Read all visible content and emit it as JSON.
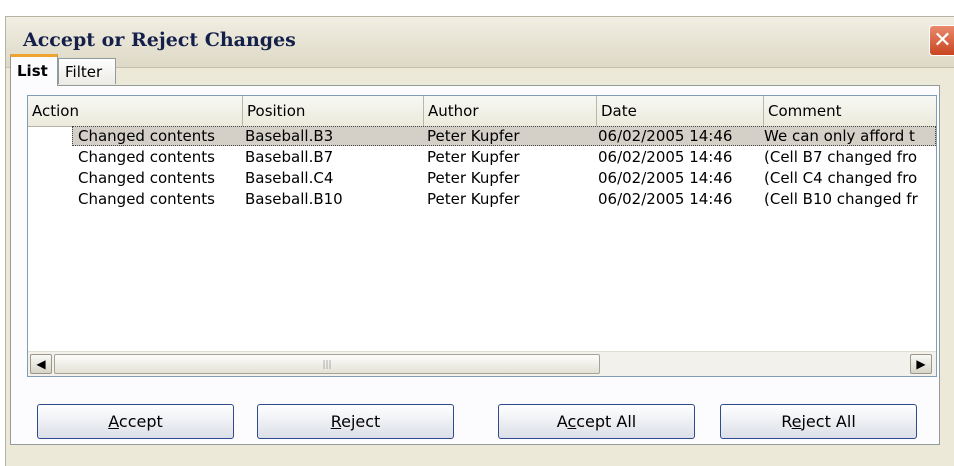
{
  "dialog": {
    "title": "Accept or Reject Changes"
  },
  "tabs": [
    {
      "label": "List",
      "active": true
    },
    {
      "label": "Filter",
      "active": false
    }
  ],
  "table": {
    "columns": [
      "Action",
      "Position",
      "Author",
      "Date",
      "Comment"
    ],
    "rows": [
      {
        "action": "Changed contents",
        "position": "Baseball.B3",
        "author": "Peter Kupfer",
        "date": "06/02/2005 14:46",
        "comment": "We can only afford t",
        "selected": true
      },
      {
        "action": "Changed contents",
        "position": "Baseball.B7",
        "author": "Peter Kupfer",
        "date": "06/02/2005 14:46",
        "comment": "(Cell B7 changed fro",
        "selected": false
      },
      {
        "action": "Changed contents",
        "position": "Baseball.C4",
        "author": "Peter Kupfer",
        "date": "06/02/2005 14:46",
        "comment": "(Cell C4 changed fro",
        "selected": false
      },
      {
        "action": "Changed contents",
        "position": "Baseball.B10",
        "author": "Peter Kupfer",
        "date": "06/02/2005 14:46",
        "comment": "(Cell B10 changed fr",
        "selected": false
      }
    ]
  },
  "buttons": {
    "accept": {
      "pre": "",
      "key": "A",
      "post": "ccept"
    },
    "reject": {
      "pre": "",
      "key": "R",
      "post": "eject"
    },
    "accept_all": {
      "pre": "A",
      "key": "c",
      "post": "cept All"
    },
    "reject_all": {
      "pre": "R",
      "key": "e",
      "post": "ject All"
    }
  },
  "icons": {
    "close": "close-icon",
    "scroll_left": "arrow-left-icon",
    "scroll_right": "arrow-right-icon",
    "grip": "scrollbar-grip-icon"
  },
  "colors": {
    "dialog_bg": "#ece9d8",
    "selected_row": "#d4d0c8",
    "close_button": "#c94420",
    "button_border": "#2d4b8e",
    "tab_highlight": "#f0a430"
  }
}
